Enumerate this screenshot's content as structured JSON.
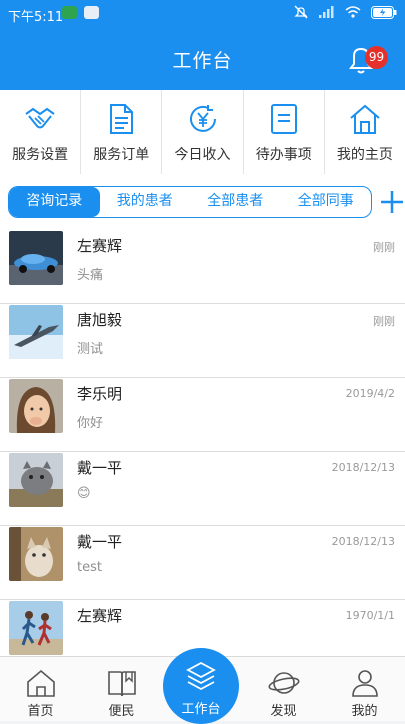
{
  "status_bar": {
    "time": "下午5:11"
  },
  "header": {
    "title": "工作台",
    "notification_count": "99"
  },
  "quick_actions": [
    {
      "label": "服务设置",
      "icon": "handshake-icon"
    },
    {
      "label": "服务订单",
      "icon": "document-icon"
    },
    {
      "label": "今日收入",
      "icon": "yuan-income-icon"
    },
    {
      "label": "待办事项",
      "icon": "todo-list-icon"
    },
    {
      "label": "我的主页",
      "icon": "home-icon"
    }
  ],
  "tabs": [
    {
      "label": "咨询记录",
      "active": true
    },
    {
      "label": "我的患者",
      "active": false
    },
    {
      "label": "全部患者",
      "active": false
    },
    {
      "label": "全部同事",
      "active": false
    }
  ],
  "conversations": [
    {
      "name": "左赛辉",
      "time": "刚刚",
      "message": "头痛"
    },
    {
      "name": "唐旭毅",
      "time": "刚刚",
      "message": "测试"
    },
    {
      "name": "李乐明",
      "time": "2019/4/2",
      "message": "你好"
    },
    {
      "name": "戴一平",
      "time": "2018/12/13",
      "message": "😊"
    },
    {
      "name": "戴一平",
      "time": "2018/12/13",
      "message": "test"
    },
    {
      "name": "左赛辉",
      "time": "1970/1/1",
      "message": ""
    }
  ],
  "bottom_nav": [
    {
      "label": "首页"
    },
    {
      "label": "便民"
    },
    {
      "label": "工作台"
    },
    {
      "label": "发现"
    },
    {
      "label": "我的"
    }
  ],
  "colors": {
    "primary": "#1a8ff0",
    "badge": "#e5312b"
  }
}
